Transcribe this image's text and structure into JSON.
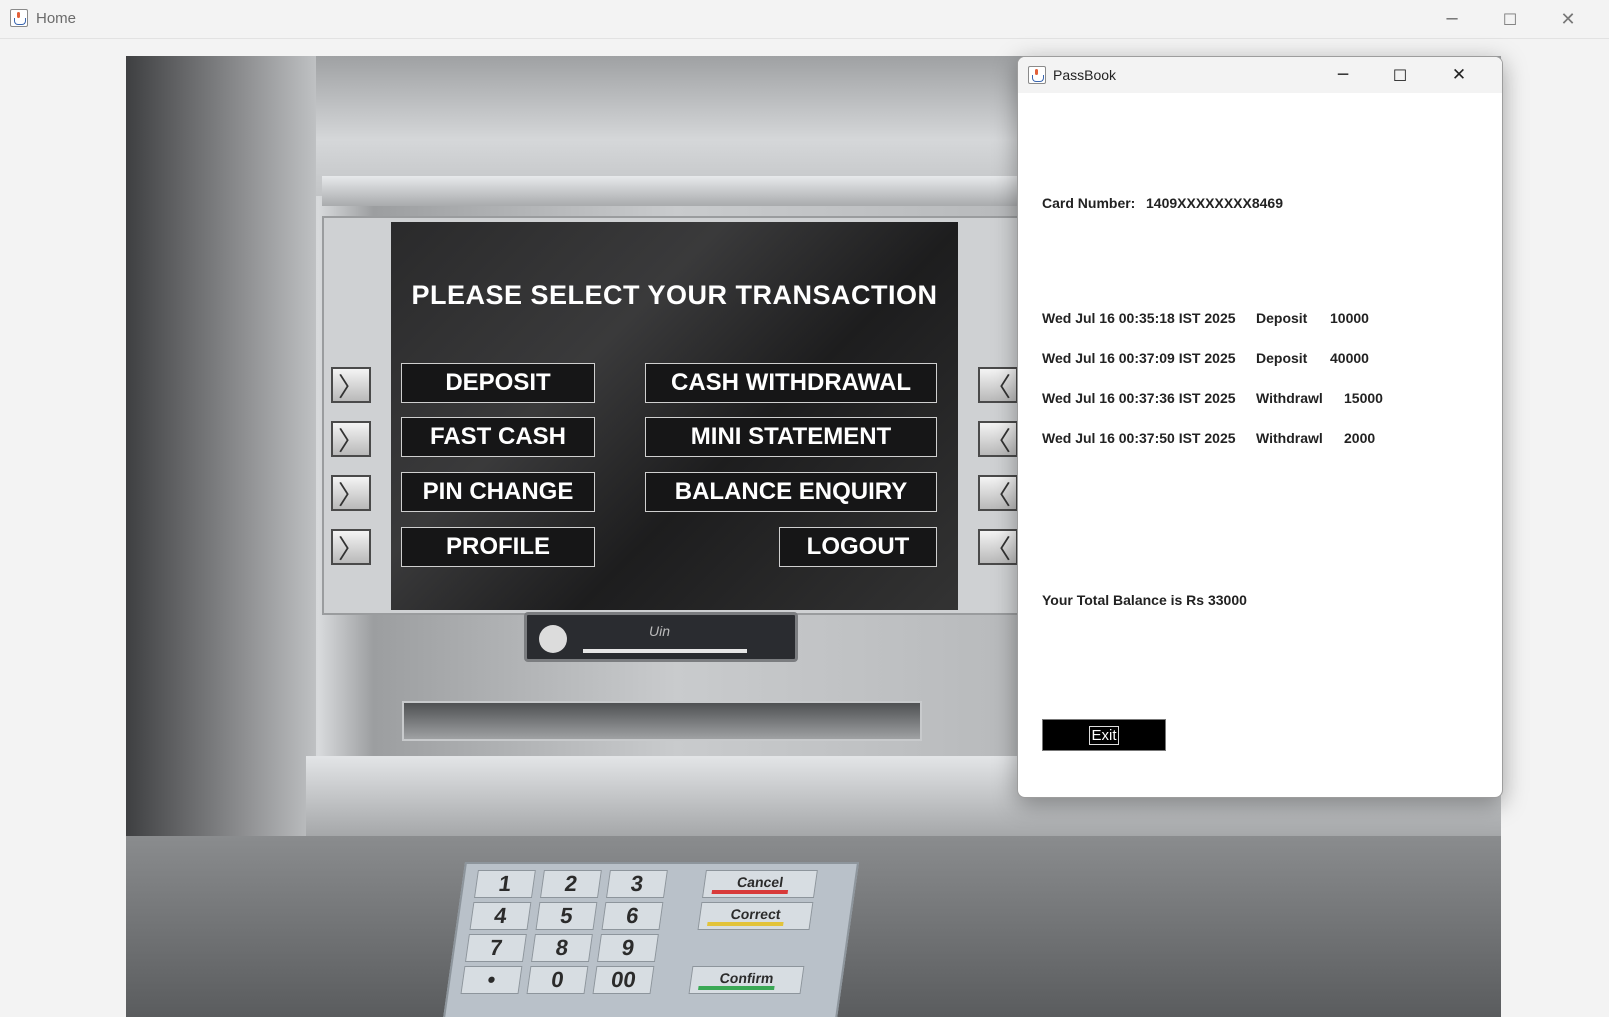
{
  "home_window": {
    "title": "Home",
    "controls": {
      "minimize": "─",
      "maximize": "☐",
      "close": "✕"
    }
  },
  "atm": {
    "screen_title": "PLEASE SELECT YOUR TRANSACTION",
    "buttons": {
      "deposit": "DEPOSIT",
      "cash_withdrawal": "CASH WITHDRAWAL",
      "fast_cash": "FAST CASH",
      "mini_statement": "MINI STATEMENT",
      "pin_change": "PIN CHANGE",
      "balance_enquiry": "BALANCE ENQUIRY",
      "profile": "PROFILE",
      "logout": "LOGOUT"
    },
    "left_key_glyph": "〉",
    "right_key_glyph": "〈",
    "card_slot_text": "Uin",
    "keypad": {
      "digits": [
        "1",
        "2",
        "3",
        "4",
        "5",
        "6",
        "7",
        "8",
        "9",
        "•",
        "0",
        "00"
      ],
      "function_keys": [
        {
          "label": "Cancel",
          "color": "#d83a3a"
        },
        {
          "label": "Correct",
          "color": "#e2c33a"
        },
        {
          "label": "Confirm",
          "color": "#3aa855"
        }
      ]
    }
  },
  "passbook": {
    "title": "PassBook",
    "controls": {
      "minimize": "─",
      "maximize": "☐",
      "close": "✕"
    },
    "card_label": "Card Number:",
    "card_number": "1409XXXXXXXX8469",
    "transactions": [
      {
        "date": "Wed Jul 16 00:35:18 IST 2025",
        "type": "Deposit",
        "amount": "10000"
      },
      {
        "date": "Wed Jul 16 00:37:09 IST 2025",
        "type": "Deposit",
        "amount": "40000"
      },
      {
        "date": "Wed Jul 16 00:37:36 IST 2025",
        "type": "Withdrawl",
        "amount": "15000"
      },
      {
        "date": "Wed Jul 16 00:37:50 IST 2025",
        "type": "Withdrawl",
        "amount": "2000"
      }
    ],
    "total_balance_text": "Your Total Balance is Rs 33000",
    "exit_label": "Exit"
  }
}
